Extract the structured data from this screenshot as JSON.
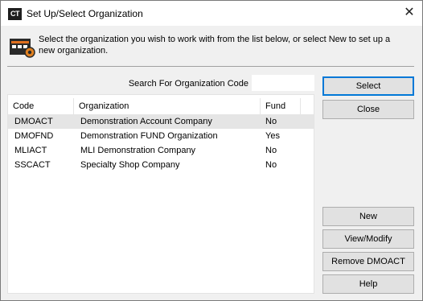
{
  "window": {
    "app_icon_text": "CT",
    "title": "Set Up/Select Organization",
    "close_glyph": "✕"
  },
  "info": {
    "icon": "organization-building-icon",
    "message": "Select the organization you wish to work with from the list below, or select New to set up a new organization."
  },
  "search": {
    "label": "Search For Organization Code",
    "value": "",
    "placeholder": ""
  },
  "table": {
    "columns": [
      "Code",
      "Organization",
      "Fund"
    ],
    "rows": [
      {
        "code": "DMOACT",
        "organization": "Demonstration Account Company",
        "fund": "No",
        "selected": true
      },
      {
        "code": "DMOFND",
        "organization": "Demonstration FUND Organization",
        "fund": "Yes",
        "selected": false
      },
      {
        "code": "MLIACT",
        "organization": "MLI Demonstration Company",
        "fund": "No",
        "selected": false
      },
      {
        "code": "SSCACT",
        "organization": "Specialty Shop Company",
        "fund": "No",
        "selected": false
      }
    ]
  },
  "buttons": {
    "select": "Select",
    "close": "Close",
    "new": "New",
    "view_modify": "View/Modify",
    "remove": "Remove DMOACT",
    "help": "Help"
  },
  "colors": {
    "selected_row": "#e5e5e5",
    "default_button_border": "#0078d7",
    "button_face": "#e1e1e1"
  }
}
